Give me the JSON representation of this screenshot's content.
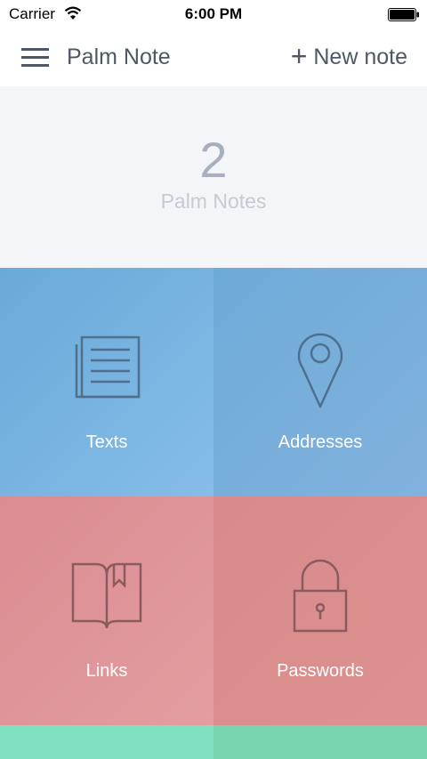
{
  "status_bar": {
    "carrier": "Carrier",
    "time": "6:00 PM"
  },
  "nav": {
    "title": "Palm Note",
    "new_note_plus": "+",
    "new_note_label": "New note"
  },
  "summary": {
    "count": "2",
    "label": "Palm Notes"
  },
  "categories": [
    {
      "label": "Texts",
      "icon": "document-icon"
    },
    {
      "label": "Addresses",
      "icon": "map-pin-icon"
    },
    {
      "label": "Links",
      "icon": "bookmark-book-icon"
    },
    {
      "label": "Passwords",
      "icon": "padlock-icon"
    }
  ],
  "colors": {
    "texts": "#6aa9d9",
    "addresses": "#6eaad8",
    "links": "#d98c91",
    "passwords": "#d98a8c",
    "bottom_left": "#80e0c2",
    "bottom_right": "#77d4ae"
  }
}
